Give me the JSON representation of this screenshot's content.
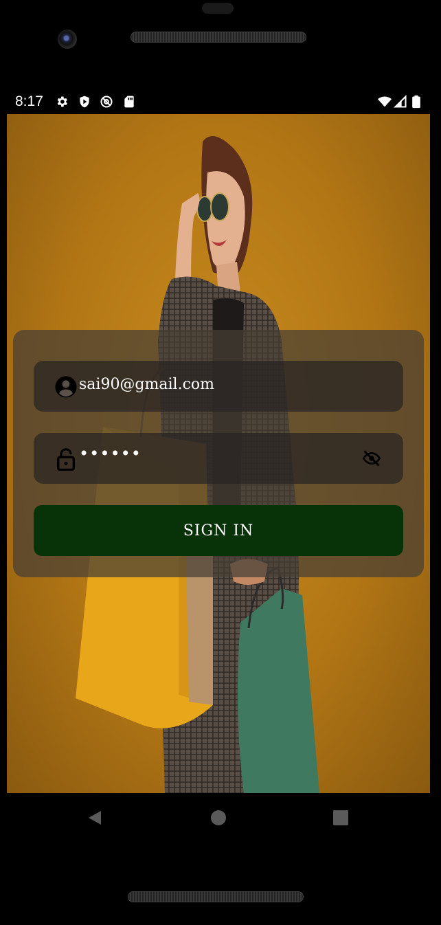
{
  "status_bar": {
    "time": "8:17",
    "left_icons": [
      "gear-icon",
      "shield-icon",
      "at-sign-icon",
      "sd-card-icon"
    ],
    "right_icons": [
      "wifi-icon",
      "signal-icon",
      "battery-icon"
    ]
  },
  "login": {
    "email_value": "sai90@gmail.com",
    "password_value": "••••••",
    "signin_label": "SIGN IN"
  },
  "colors": {
    "background": "#b27615",
    "card": "#463e34",
    "field": "#282422",
    "signin_button": "#083207",
    "text": "#ffffff"
  },
  "nav_bar": {
    "buttons": [
      "back-icon",
      "home-icon",
      "recents-icon"
    ]
  }
}
